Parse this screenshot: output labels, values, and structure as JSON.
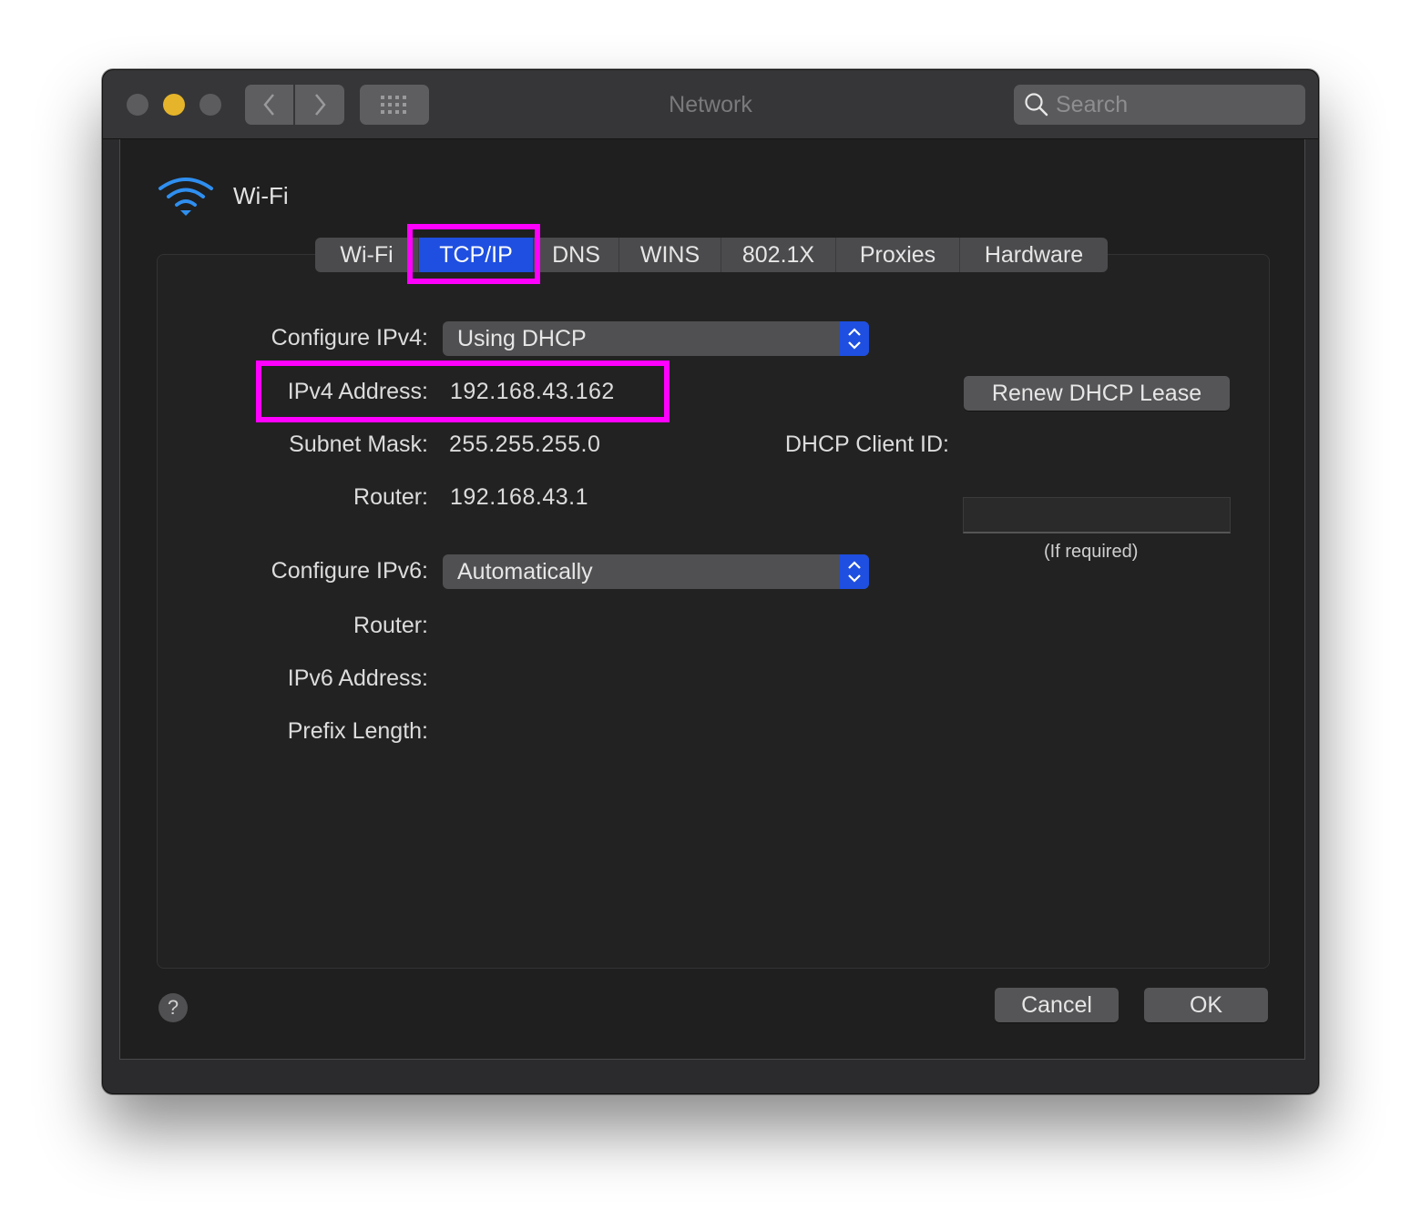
{
  "window": {
    "title": "Network",
    "search_placeholder": "Search",
    "traffic_lights": [
      "close",
      "minimize",
      "zoom"
    ]
  },
  "interface": {
    "name": "Wi-Fi",
    "icon": "wifi-icon",
    "accent_color": "#2f8ff0"
  },
  "tabs": [
    {
      "label": "Wi-Fi",
      "active": false
    },
    {
      "label": "TCP/IP",
      "active": true
    },
    {
      "label": "DNS",
      "active": false
    },
    {
      "label": "WINS",
      "active": false
    },
    {
      "label": "802.1X",
      "active": false
    },
    {
      "label": "Proxies",
      "active": false
    },
    {
      "label": "Hardware",
      "active": false
    }
  ],
  "ipv4": {
    "configure_label": "Configure IPv4:",
    "configure_value": "Using DHCP",
    "address_label": "IPv4 Address:",
    "address_value": "192.168.43.162",
    "subnet_label": "Subnet Mask:",
    "subnet_value": "255.255.255.0",
    "router_label": "Router:",
    "router_value": "192.168.43.1"
  },
  "dhcp": {
    "renew_button": "Renew DHCP Lease",
    "client_id_label": "DHCP Client ID:",
    "client_id_value": "",
    "client_id_hint": "(If required)"
  },
  "ipv6": {
    "configure_label": "Configure IPv6:",
    "configure_value": "Automatically",
    "router_label": "Router:",
    "address_label": "IPv6 Address:",
    "prefix_label": "Prefix Length:"
  },
  "footer": {
    "help_label": "?",
    "cancel_label": "Cancel",
    "ok_label": "OK"
  },
  "colors": {
    "highlight": "#ff00ff",
    "active_tab": "#1f4fe0",
    "minimize_light": "#e5b42a"
  }
}
